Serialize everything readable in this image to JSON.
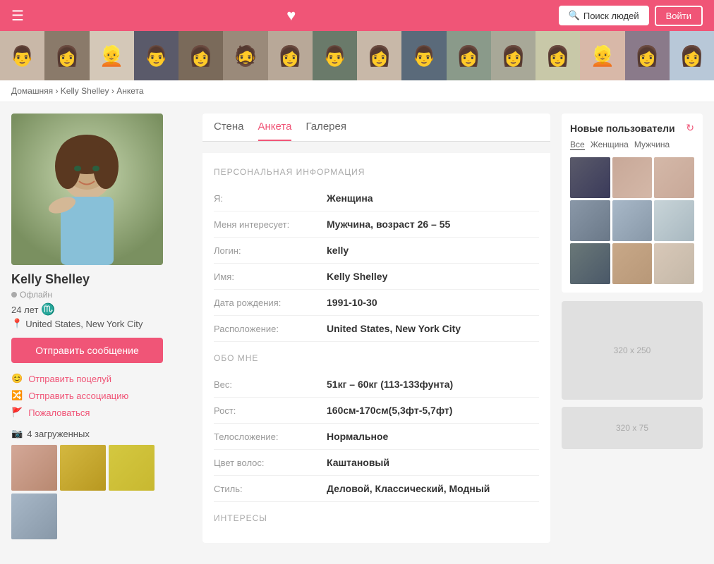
{
  "header": {
    "menu_icon": "☰",
    "heart_icon": "♥",
    "search_button": "Поиск людей",
    "login_button": "Войти",
    "search_icon": "🔍"
  },
  "breadcrumb": {
    "home": "Домашняя",
    "separator": ">",
    "name": "Kelly Shelley",
    "page": "Анкета"
  },
  "profile": {
    "name": "Kelly Shelley",
    "status": "Офлайн",
    "age": "24 лет",
    "zodiac": "♏",
    "location": "United States, New York City",
    "message_button": "Отправить сообщение",
    "action_kiss": "Отправить поцелуй",
    "action_association": "Отправить ассоциацию",
    "action_report": "Пожаловаться",
    "photos_count": "4 загруженных"
  },
  "tabs": {
    "wall": "Стена",
    "profile": "Анкета",
    "gallery": "Галерея"
  },
  "personal_info": {
    "section_title": "ПЕРСОНАЛЬНАЯ ИНФОРМАЦИЯ",
    "fields": [
      {
        "label": "Я:",
        "value": "Женщина"
      },
      {
        "label": "Меня интересует:",
        "value": "Мужчина, возраст 26 – 55"
      },
      {
        "label": "Логин:",
        "value": "kelly"
      },
      {
        "label": "Имя:",
        "value": "Kelly Shelley"
      },
      {
        "label": "Дата рождения:",
        "value": "1991-10-30"
      },
      {
        "label": "Расположение:",
        "value": "United States, New York City"
      }
    ]
  },
  "about_me": {
    "section_title": "ОБО МНЕ",
    "fields": [
      {
        "label": "Вес:",
        "value": "51кг – 60кг (113-133фунта)"
      },
      {
        "label": "Рост:",
        "value": "160см-170см(5,3фт-5,7фт)"
      },
      {
        "label": "Телосложение:",
        "value": "Нормальное"
      },
      {
        "label": "Цвет волос:",
        "value": "Каштановый"
      },
      {
        "label": "Стиль:",
        "value": "Деловой, Классический, Модный"
      }
    ]
  },
  "interests": {
    "section_title": "ИНТЕРЕСЫ"
  },
  "new_users": {
    "title": "Новые пользователи",
    "filter_all": "Все",
    "filter_female": "Женщина",
    "filter_male": "Мужчина"
  },
  "ads": {
    "large": "320 x 250",
    "small": "320 x 75"
  },
  "strip_photos": [
    "👨",
    "👩",
    "👱",
    "👨",
    "👩",
    "🧔",
    "👩",
    "👨",
    "👩",
    "👨",
    "👩",
    "👩",
    "👩",
    "👩",
    "👱",
    "👩"
  ]
}
